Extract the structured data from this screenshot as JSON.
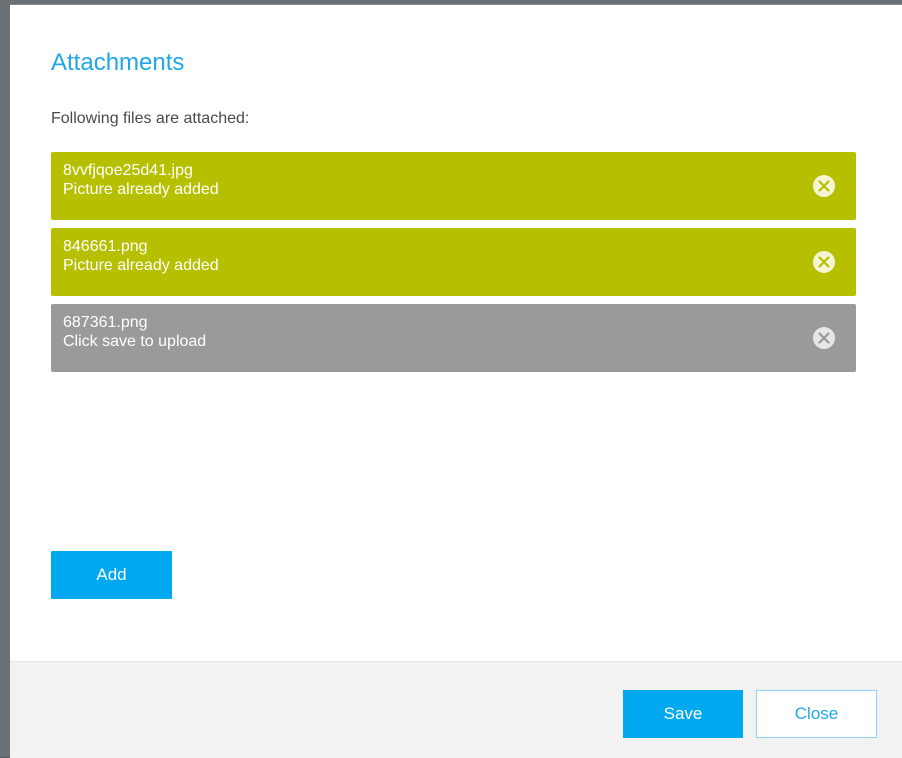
{
  "dialog": {
    "title": "Attachments",
    "subtitle": "Following files are attached:"
  },
  "files": [
    {
      "name": "8vvfjqoe25d41.jpg",
      "status": "Picture already added",
      "state": "added"
    },
    {
      "name": "846661.png",
      "status": "Picture already added",
      "state": "added"
    },
    {
      "name": "687361.png",
      "status": "Click save to upload",
      "state": "pending"
    }
  ],
  "buttons": {
    "add_label": "Add",
    "save_label": "Save",
    "close_label": "Close"
  },
  "colors": {
    "accent": "#1fa7e6",
    "primary_button": "#00a8f0",
    "added_bg": "#b6c000",
    "pending_bg": "#9a9a9a"
  },
  "icons": {
    "remove": "close-circle-icon"
  }
}
